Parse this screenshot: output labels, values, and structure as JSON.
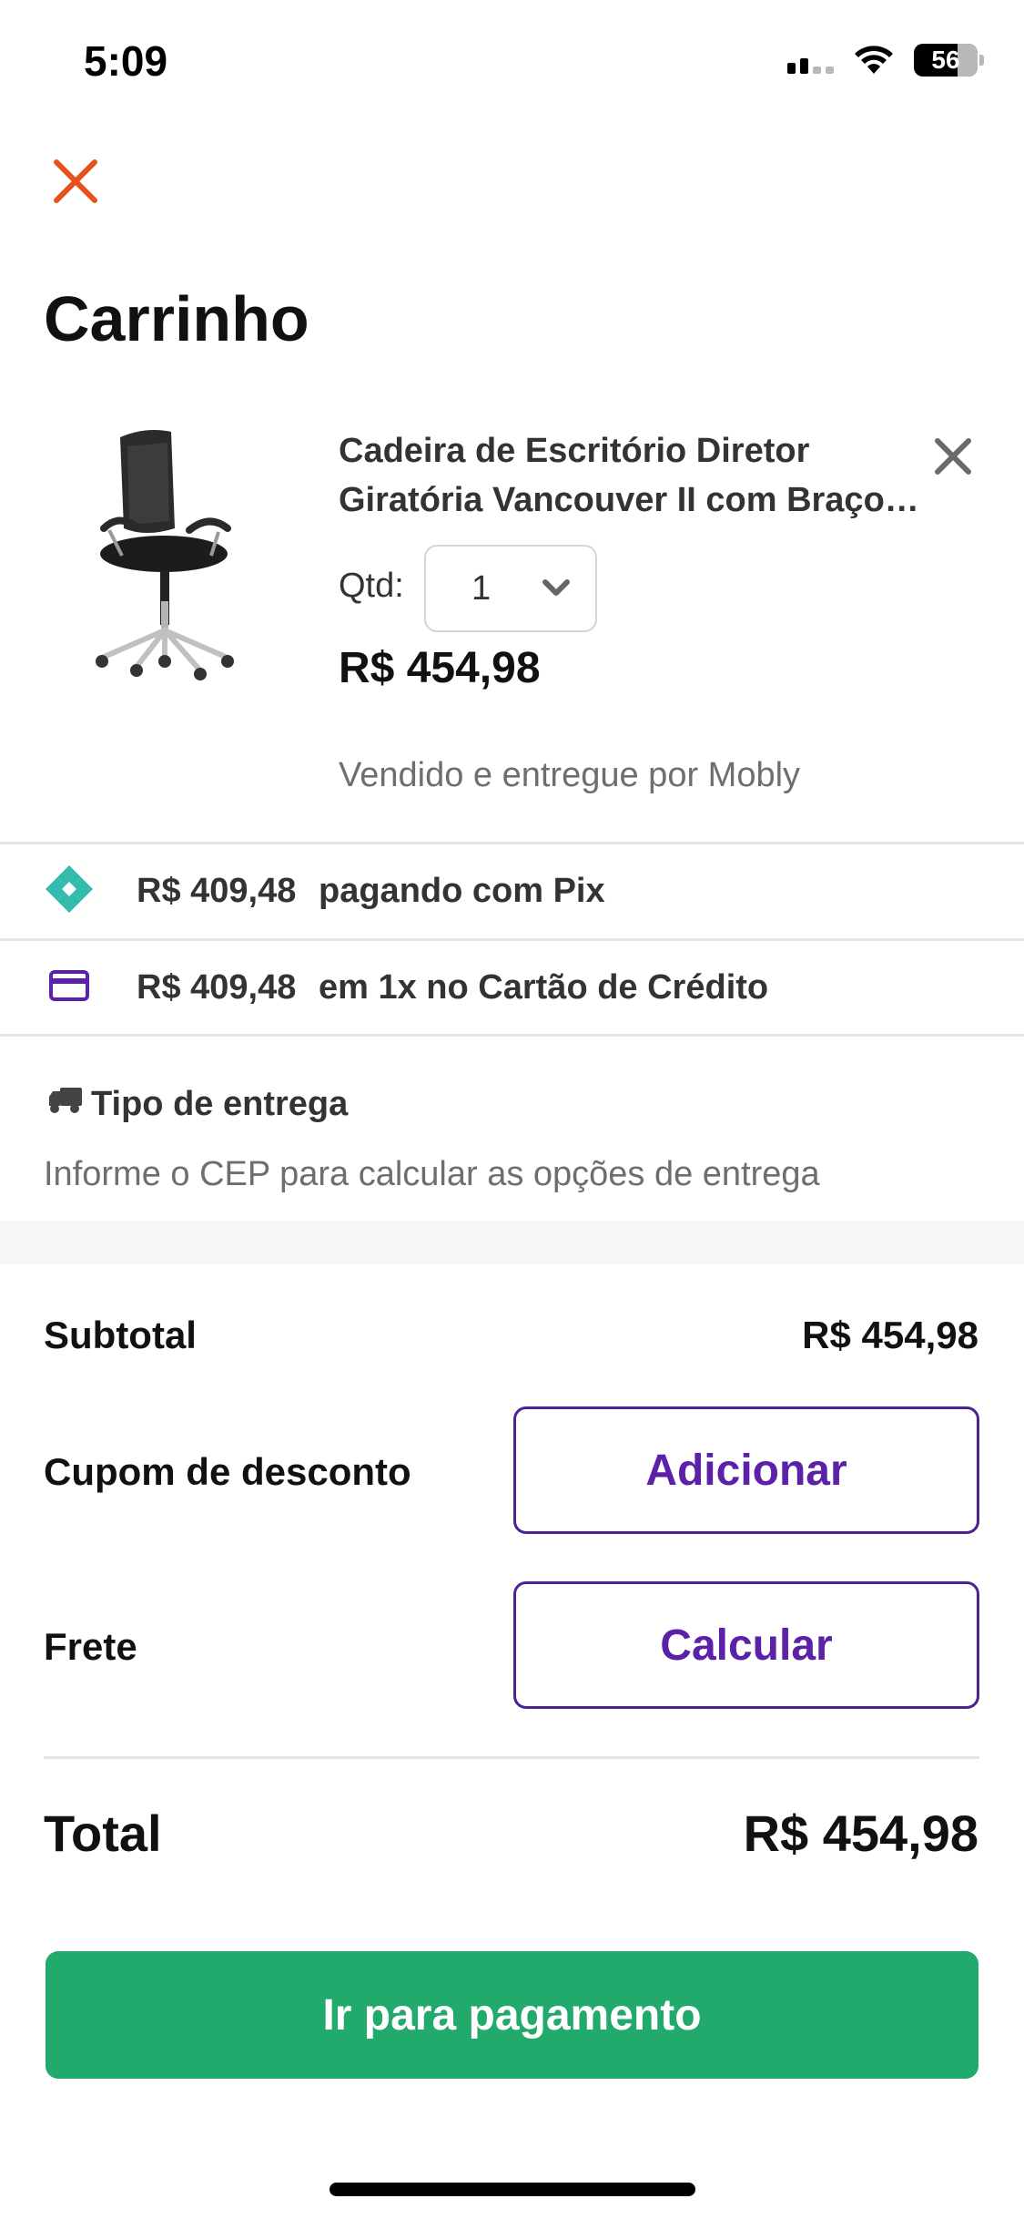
{
  "status_bar": {
    "time": "5:09",
    "battery": "56"
  },
  "icons": {
    "close": "close-icon",
    "remove": "remove-item-icon",
    "chevron": "chevron-down-icon",
    "pix": "pix-icon",
    "card": "credit-card-icon",
    "truck": "truck-icon"
  },
  "header": {
    "title": "Carrinho"
  },
  "product": {
    "name_line1": "Cadeira de Escritório Diretor",
    "name_line2": "Giratória Vancouver II com Braços Preta",
    "qty_label": "Qtd:",
    "qty_value": "1",
    "price": "R$ 454,98",
    "seller": "Vendido e entregue por Mobly"
  },
  "payment_options": [
    {
      "amount": "R$ 409,48",
      "description": "pagando com Pix"
    },
    {
      "amount": "R$ 409,48",
      "description": "em 1x no Cartão de Crédito"
    }
  ],
  "delivery": {
    "title": "Tipo de entrega",
    "hint": "Informe o CEP para calcular as opções de entrega"
  },
  "summary": {
    "subtotal_label": "Subtotal",
    "subtotal_value": "R$ 454,98",
    "coupon_label": "Cupom de desconto",
    "coupon_button": "Adicionar",
    "shipping_label": "Frete",
    "shipping_button": "Calcular",
    "total_label": "Total",
    "total_value": "R$ 454,98"
  },
  "checkout_button": "Ir para pagamento",
  "colors": {
    "close": "#e8521a",
    "accent_purple": "#5b21a8",
    "pix": "#32bcad",
    "primary_green": "#22a96c"
  }
}
